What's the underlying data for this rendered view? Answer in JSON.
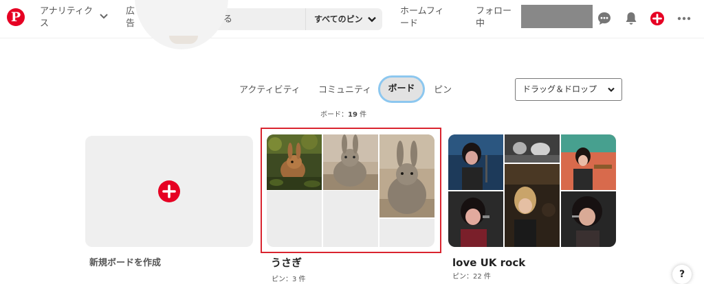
{
  "brand": {
    "logo_glyph": "P",
    "accent": "#e60023"
  },
  "nav": {
    "analytics_label": "アナリティクス",
    "ads_label": "広告",
    "home_feed_label": "ホームフィード",
    "following_label": "フォロー中"
  },
  "search": {
    "placeholder": "検索する",
    "scope_label": "すべてのピン"
  },
  "tabs": {
    "activity": "アクティビティ",
    "community": "コミュニティ",
    "boards": "ボード",
    "pins": "ピン"
  },
  "sort": {
    "label": "ドラッグ＆ドロップ"
  },
  "board_count": {
    "label": "ボード：",
    "value": "19",
    "unit": " 件"
  },
  "create_board": {
    "label": "新規ボードを作成"
  },
  "boards": [
    {
      "title": "うさぎ",
      "subtitle": "ピン：3 件",
      "highlight_color": "#d9232e"
    },
    {
      "title": "love UK rock",
      "subtitle": "ピン：22 件"
    }
  ],
  "help": {
    "label": "?"
  },
  "icons": [
    "pinterest-logo-icon",
    "chevron-down-icon",
    "search-icon",
    "chat-bubble-icon",
    "bell-icon",
    "plus-icon",
    "more-icon"
  ]
}
